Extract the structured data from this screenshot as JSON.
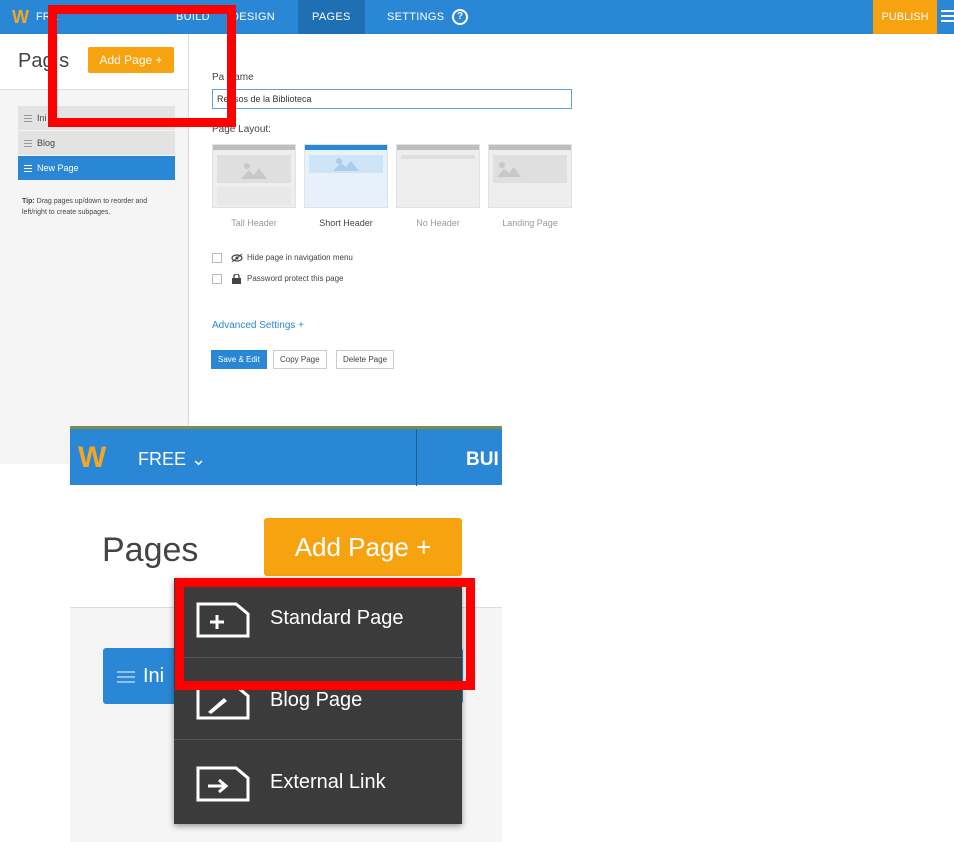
{
  "topbar": {
    "logo": "W",
    "free_label": "FRE",
    "nav": [
      "BUILD",
      "DESIGN",
      "PAGES",
      "SETTINGS"
    ],
    "active_nav": "PAGES",
    "help": "?",
    "publish": "PUBLISH"
  },
  "sidebar": {
    "title": "Pag s",
    "add_page": "Add Page +",
    "pages": [
      {
        "label": "Ini",
        "active": false
      },
      {
        "label": "Blog",
        "active": false
      },
      {
        "label": "New Page",
        "active": true
      }
    ],
    "tip_bold": "Tip:",
    "tip_text": "Drag pages up/down to reorder and left/right to create subpages."
  },
  "settings": {
    "page_name_label": "Pa  Name",
    "page_name_value": "Re  rsos de la Biblioteca",
    "page_layout_label": "Page Layout:",
    "layouts": [
      {
        "name": "Tall Header",
        "selected": false
      },
      {
        "name": "Short Header",
        "selected": true
      },
      {
        "name": "No Header",
        "selected": false
      },
      {
        "name": "Landing Page",
        "selected": false
      }
    ],
    "hide_label": "Hide page in navigation menu",
    "password_label": "Password protect this page",
    "advanced": "Advanced Settings  +",
    "buttons": {
      "save_edit": "Save & Edit",
      "copy": "Copy Page",
      "delete": "Delete Page"
    }
  },
  "zoom": {
    "logo": "W",
    "free": "FREE ⌄",
    "build": "BUI",
    "title": "Pages",
    "add_page": "Add Page +",
    "first_page": "Ini",
    "menu": [
      {
        "label": "Standard Page",
        "icon": "standard-page-icon"
      },
      {
        "label": "Blog Page",
        "icon": "blog-page-icon"
      },
      {
        "label": "External Link",
        "icon": "external-link-icon"
      }
    ]
  },
  "colors": {
    "brand_blue": "#2a87d5",
    "publish_orange": "#f7a20f",
    "highlight_red": "#ff0000",
    "menu_dark": "#3b3b3b"
  }
}
